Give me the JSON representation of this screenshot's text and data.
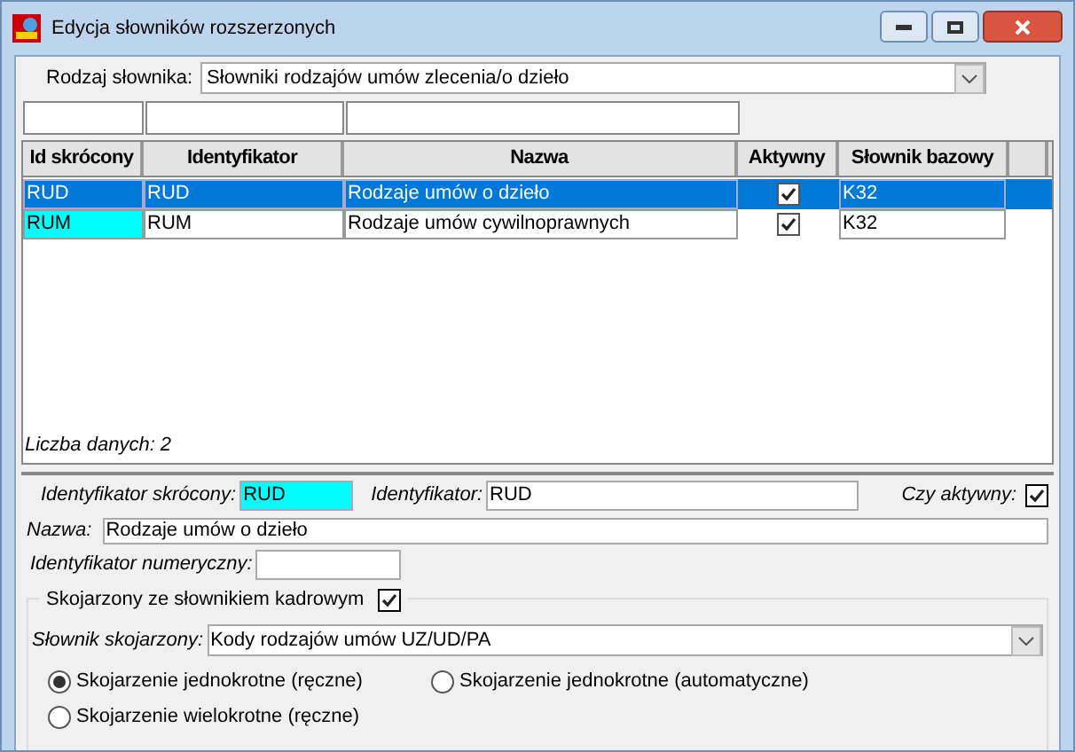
{
  "window": {
    "title": "Edycja słowników rozszerzonych"
  },
  "dictionary_type": {
    "label": "Rodzaj słownika:",
    "value": "Słowniki rodzajów umów zlecenia/o dzieło"
  },
  "table": {
    "columns": [
      "Id skrócony",
      "Identyfikator",
      "Nazwa",
      "Aktywny",
      "Słownik bazowy"
    ],
    "rows": [
      {
        "id": "RUD",
        "identifier": "RUD",
        "name": "Rodzaje umów o dzieło",
        "active": true,
        "base": "K32",
        "selected": true
      },
      {
        "id": "RUM",
        "identifier": "RUM",
        "name": "Rodzaje umów cywilnoprawnych",
        "active": true,
        "base": "K32",
        "selected": false
      }
    ],
    "count": "Liczba danych: 2"
  },
  "details": {
    "short_id_label": "Identyfikator skrócony:",
    "short_id": "RUD",
    "identifier_label": "Identyfikator:",
    "identifier": "RUD",
    "active_label": "Czy aktywny:",
    "active": true,
    "name_label": "Nazwa:",
    "name": "Rodzaje umów o dzieło",
    "numeric_id_label": "Identyfikator numeryczny:",
    "linked_label": "Skojarzony ze słownikiem kadrowym",
    "linked": true,
    "linked_dict_label": "Słownik skojarzony:",
    "linked_dict": "Kody rodzajów umów UZ/UD/PA",
    "options": [
      {
        "label": "Skojarzenie jednokrotne (ręczne)",
        "selected": true
      },
      {
        "label": "Skojarzenie jednokrotne (automatyczne)",
        "selected": false
      },
      {
        "label": "Skojarzenie wielokrotne (ręczne)",
        "selected": false
      }
    ]
  }
}
